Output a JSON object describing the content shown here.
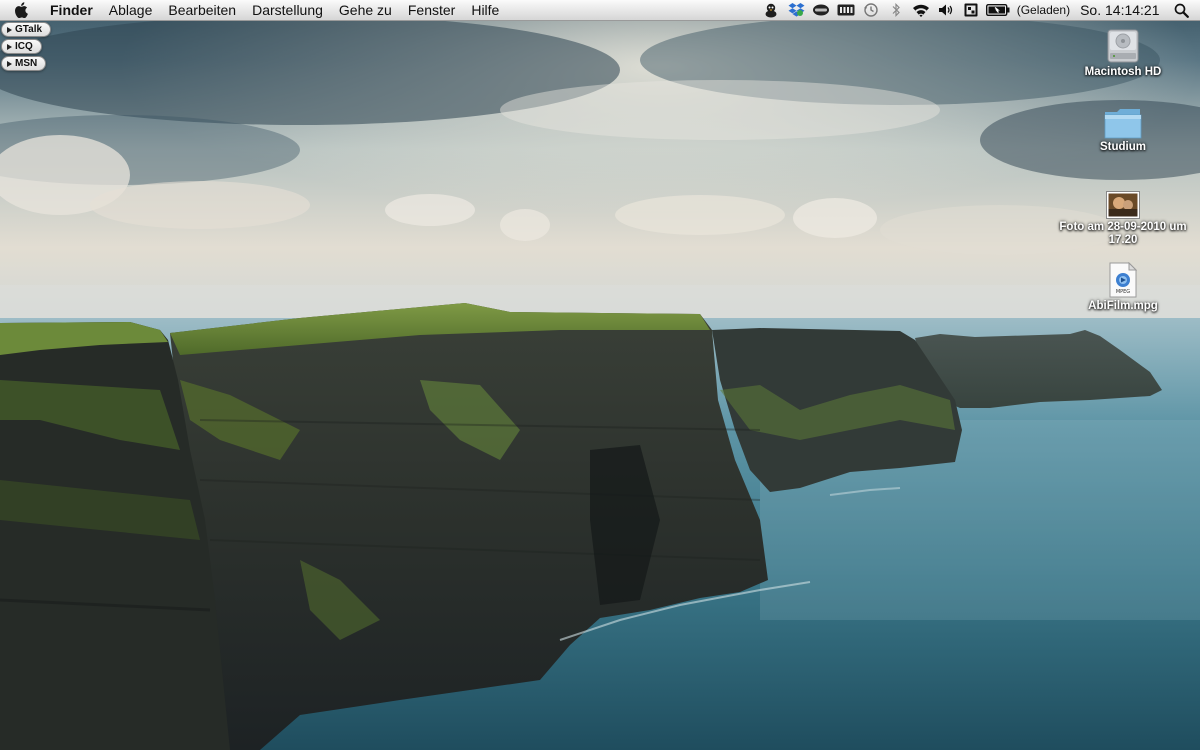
{
  "menubar": {
    "apple_icon": "apple-icon",
    "app_name": "Finder",
    "items": [
      {
        "label": "Ablage"
      },
      {
        "label": "Bearbeiten"
      },
      {
        "label": "Darstellung"
      },
      {
        "label": "Gehe zu"
      },
      {
        "label": "Fenster"
      },
      {
        "label": "Hilfe"
      }
    ],
    "status": {
      "icons": [
        "adium-duck-icon",
        "dropbox-icon",
        "cpu-monitor-icon",
        "battery-meter-icon",
        "time-machine-icon",
        "bluetooth-icon",
        "wifi-icon",
        "volume-icon",
        "spaces-icon",
        "battery-icon"
      ],
      "battery_text": "(Geladen)",
      "clock": "So. 14:14:21",
      "search_icon": "spotlight-search-icon"
    }
  },
  "im_pills": [
    {
      "label": "GTalk"
    },
    {
      "label": "ICQ"
    },
    {
      "label": "MSN"
    }
  ],
  "desktop_icons": [
    {
      "label": "Macintosh HD",
      "icon": "hard-drive-icon"
    },
    {
      "label": "Studium",
      "icon": "folder-icon"
    },
    {
      "label": "Foto am 28-09-2010 um 17.20",
      "icon": "photo-thumbnail-icon"
    },
    {
      "label": "AbiFilm.mpg",
      "icon": "mpeg-file-icon",
      "badge": "MPEG"
    }
  ],
  "colors": {
    "menubar_top": "#fbfbfb",
    "menubar_bottom": "#d6d6d6",
    "folder_blue": "#8fc6ea",
    "sea": "#3f7f92",
    "sky": "#cfd6d2"
  }
}
